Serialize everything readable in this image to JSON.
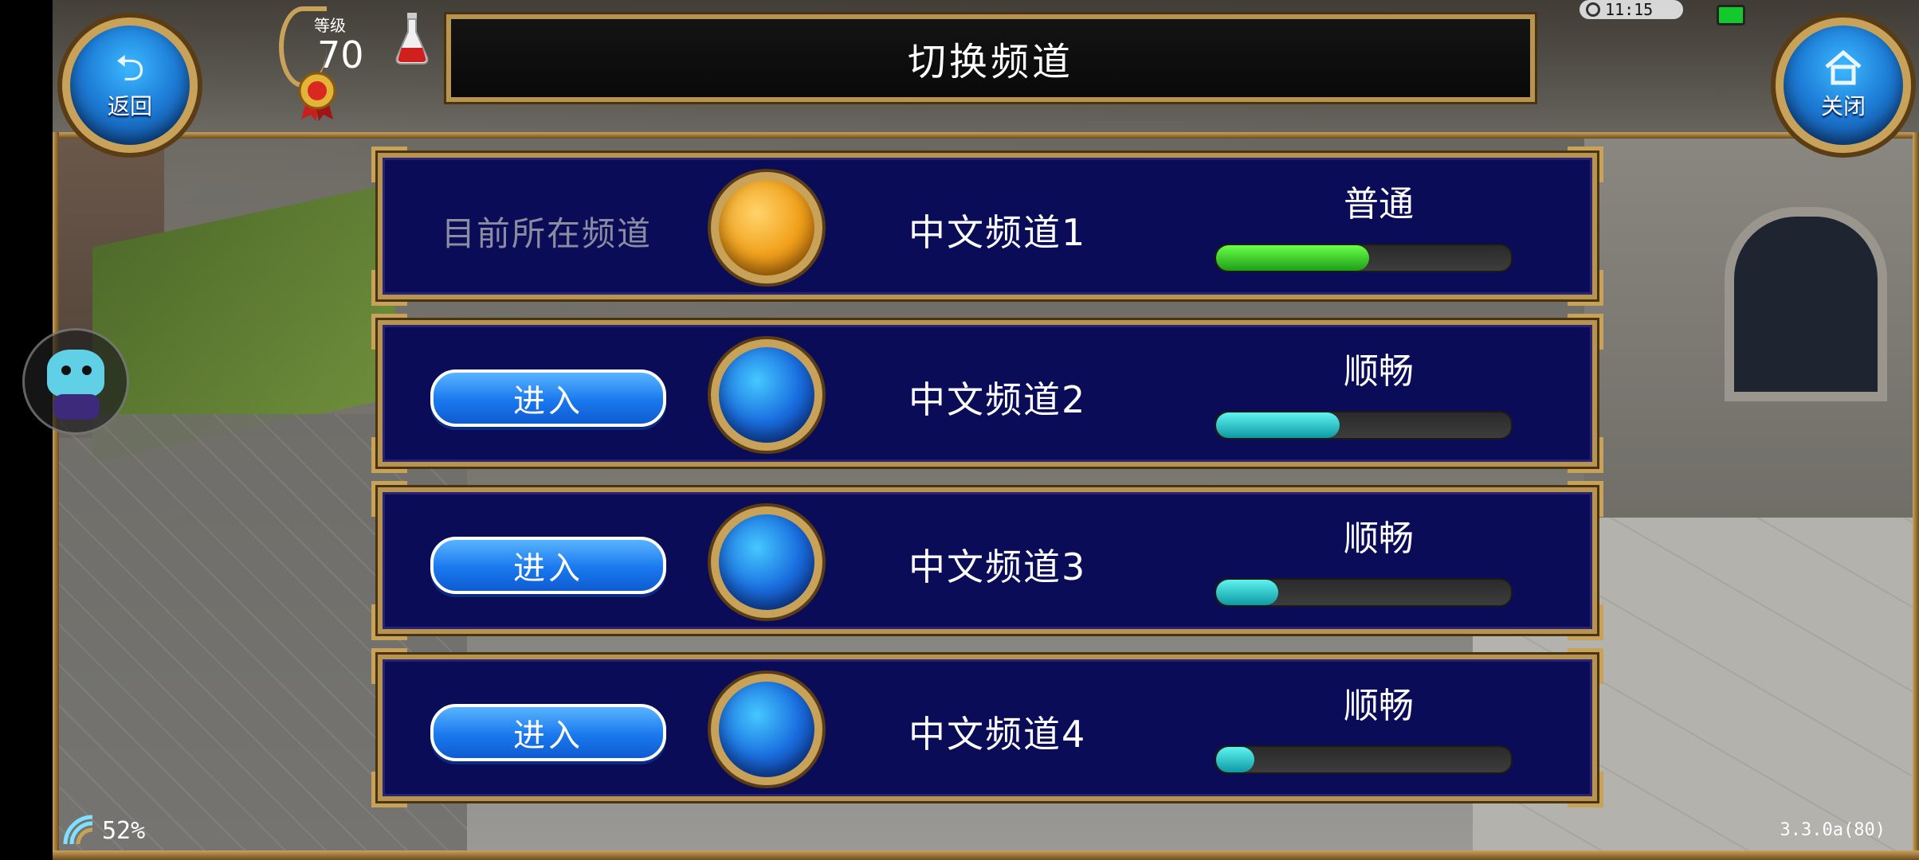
{
  "header": {
    "back_label": "返回",
    "close_label": "关闭",
    "level_label": "等级",
    "level_value": "70",
    "title": "切换频道"
  },
  "status_bar": {
    "time": "11:15"
  },
  "current_channel_label": "目前所在频道",
  "channels": [
    {
      "name": "中文频道1",
      "status": "普通",
      "load": 0.52,
      "current": true
    },
    {
      "name": "中文频道2",
      "status": "顺畅",
      "load": 0.42,
      "current": false,
      "button": "进入"
    },
    {
      "name": "中文频道3",
      "status": "顺畅",
      "load": 0.21,
      "current": false,
      "button": "进入"
    },
    {
      "name": "中文频道4",
      "status": "顺畅",
      "load": 0.13,
      "current": false,
      "button": "进入"
    }
  ],
  "footer": {
    "signal_percent": "52%",
    "version": "3.3.0a(80)"
  },
  "colors": {
    "panel_bg": "#0a0c58",
    "frame_gold": "#c9a25a",
    "bar_green": "#1e9e16",
    "bar_teal": "#0d9aa4",
    "enter_blue": "#1a78ee"
  },
  "icons": {
    "back": "undo-arrow-icon",
    "close": "home-icon",
    "medal": "medal-icon",
    "potion": "potion-icon",
    "avatar": "dino-avatar-icon",
    "signal": "wifi-signal-icon",
    "battery": "battery-icon",
    "clock": "clock-icon"
  }
}
